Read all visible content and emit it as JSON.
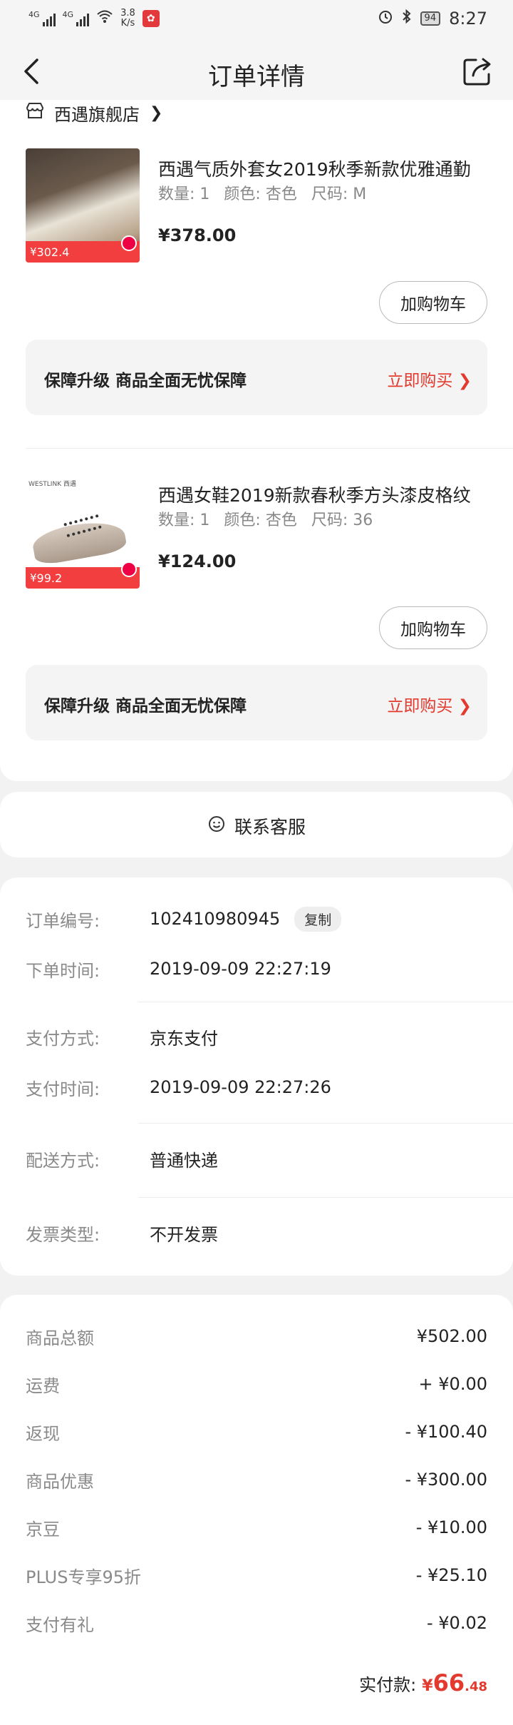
{
  "status_bar": {
    "sig1": "4G",
    "sig2": "4G",
    "speed": "3.8",
    "speed_unit": "K/s",
    "battery": "94",
    "time": "8:27"
  },
  "nav": {
    "title": "订单详情"
  },
  "shop": {
    "name": "西遇旗舰店"
  },
  "products": [
    {
      "title": "西遇气质外套女2019秋季新款优雅通勤",
      "qty_label": "数量:",
      "qty": "1",
      "color_label": "颜色:",
      "color": "杏色",
      "size_label": "尺码:",
      "size": "M",
      "price": "¥378.00",
      "badge_price": "302.4",
      "cart_label": "加购物车"
    },
    {
      "title": "西遇女鞋2019新款春秋季方头漆皮格纹",
      "qty_label": "数量:",
      "qty": "1",
      "color_label": "颜色:",
      "color": "杏色",
      "size_label": "尺码:",
      "size": "36",
      "price": "¥124.00",
      "badge_price": "99.2",
      "brand_text": "WESTLINK 西遇",
      "cart_label": "加购物车"
    }
  ],
  "guarantee": {
    "text": "保障升级  商品全面无忧保障",
    "buy": "立即购买 ❯"
  },
  "customer_service": {
    "label": "联系客服"
  },
  "order_info": {
    "order_no_label": "订单编号:",
    "order_no": "102410980945",
    "copy": "复制",
    "order_time_label": "下单时间:",
    "order_time": "2019-09-09  22:27:19",
    "pay_method_label": "支付方式:",
    "pay_method": "京东支付",
    "pay_time_label": "支付时间:",
    "pay_time": "2019-09-09  22:27:26",
    "delivery_label": "配送方式:",
    "delivery": "普通快递",
    "invoice_label": "发票类型:",
    "invoice": "不开发票"
  },
  "summary": {
    "rows": [
      {
        "label": "商品总额",
        "value": "¥502.00"
      },
      {
        "label": "运费",
        "value": "+ ¥0.00"
      },
      {
        "label": "返现",
        "value": "- ¥100.40"
      },
      {
        "label": "商品优惠",
        "value": "- ¥300.00"
      },
      {
        "label": "京豆",
        "value": "- ¥10.00"
      },
      {
        "label": "PLUS专享95折",
        "value": "- ¥25.10"
      },
      {
        "label": "支付有礼",
        "value": "- ¥0.02"
      }
    ],
    "total_label": "实付款:",
    "total_currency": "¥",
    "total_int": "66",
    "total_dec": ".48"
  },
  "colors": {
    "accent": "#e23a2e",
    "label_gray": "#8a8a8a"
  },
  "icons": [
    "back-arrow-icon",
    "share-icon",
    "store-icon",
    "chevron-right-icon",
    "smiley-icon",
    "alarm-icon",
    "bluetooth-icon",
    "wifi-icon",
    "battery-icon"
  ]
}
